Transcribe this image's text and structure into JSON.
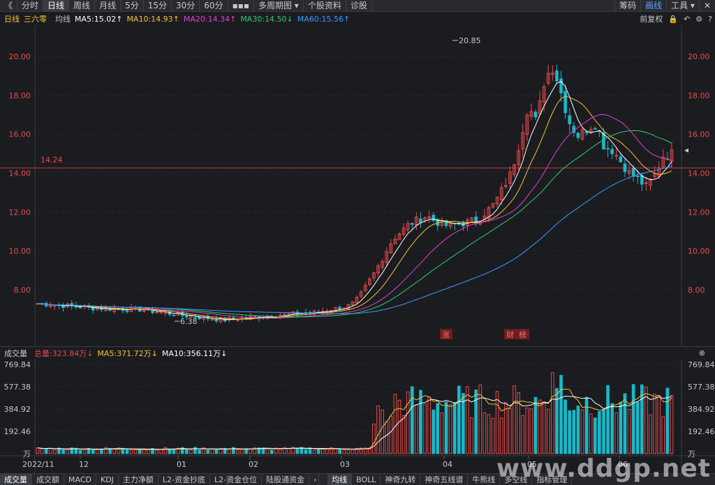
{
  "toolbar": {
    "back_glyph": "《",
    "tabs": [
      "分时",
      "日线",
      "周线",
      "月线",
      "5分",
      "15分",
      "30分",
      "60分",
      "▪▪▪",
      "多周期图 ▾",
      "个股资料",
      "诊股"
    ],
    "active_tab": 1,
    "right": [
      "筹码",
      "画线",
      "工具 ▾",
      "✕"
    ]
  },
  "ma_row": {
    "period": "日线",
    "stock_name": "三六零",
    "label_avg": "均线",
    "ma5": "MA5:15.02↑",
    "ma10": "MA10:14.93↑",
    "ma20": "MA20:14.34↑",
    "ma30": "MA30:14.50↓",
    "ma60": "MA60:15.56↑",
    "adjust": "前复权",
    "colors": {
      "ma5": "#ffffff",
      "ma10": "#f5c32d",
      "ma20": "#e040d0",
      "ma30": "#2ecc71",
      "ma60": "#3b9bff",
      "up": "#e84a4a",
      "down": "#19b9c8"
    }
  },
  "price_axis": {
    "ticks": [
      "20.00",
      "18.00",
      "16.00",
      "14.00",
      "12.00",
      "10.00",
      "8.00"
    ]
  },
  "annotations": {
    "high_label": "20.85",
    "low_label": "6.38",
    "ref_line": "14.24",
    "event_zhang": "涨",
    "event_cai": "财",
    "event_bang": "榜"
  },
  "volume": {
    "title": "成交量",
    "total": "总量:323.84万↓",
    "ma5": "MA5:371.72万↓",
    "ma10": "MA10:356.11万↓",
    "axis": [
      "769.84",
      "577.38",
      "384.92",
      "192.46",
      "万"
    ]
  },
  "x_axis": [
    "2022/11",
    "12",
    "01",
    "02",
    "03",
    "04",
    "05",
    "06"
  ],
  "bottom_tabs": {
    "left": [
      "成交量",
      "成交额",
      "MACD",
      "KDJ",
      "主力净额",
      "L2-资金抄底",
      "L2-资金仓位",
      "陆股通资金"
    ],
    "right": [
      "均线",
      "BOLL",
      "神奇九转",
      "神奇五线谱",
      "牛熊线",
      "多空线",
      "指标管理"
    ]
  },
  "watermark": "www.ddgp.net"
}
